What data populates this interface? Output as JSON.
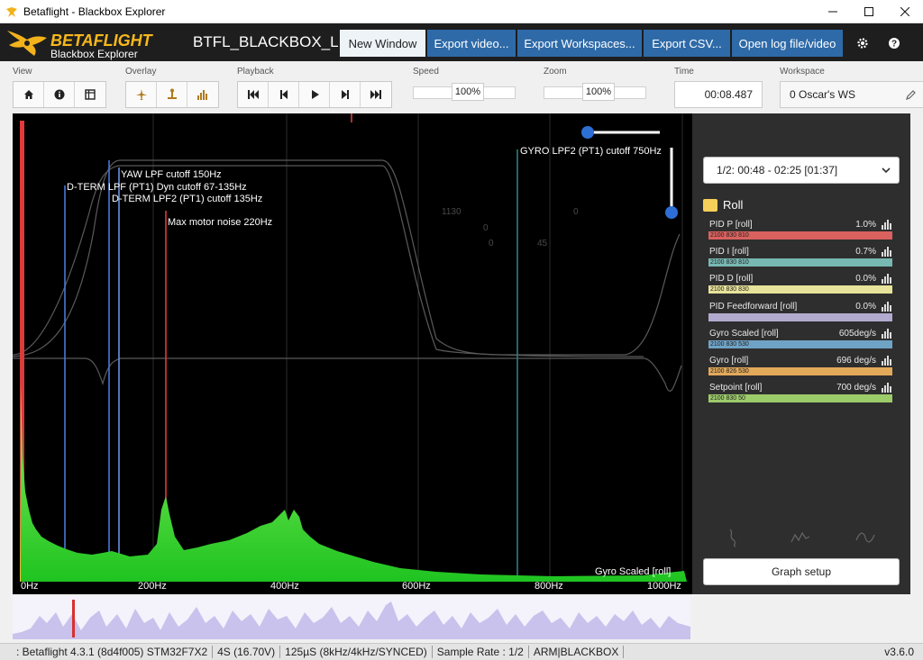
{
  "window": {
    "title": "Betaflight - Blackbox Explorer"
  },
  "header": {
    "logo_main": "BETAFLIGHT",
    "logo_sub": "Blackbox Explorer",
    "log_name": "BTFL_BLACKBOX_LO",
    "buttons": {
      "new_window": "New Window",
      "export_video": "Export video...",
      "export_workspaces": "Export Workspaces...",
      "export_csv": "Export CSV...",
      "open_log": "Open log file/video"
    },
    "icons": [
      "settings-icon",
      "help-icon"
    ]
  },
  "toolbar": {
    "labels": {
      "view": "View",
      "overlay": "Overlay",
      "playback": "Playback",
      "speed": "Speed",
      "zoom": "Zoom",
      "time": "Time",
      "workspace": "Workspace"
    },
    "speed_value": "100%",
    "zoom_value": "100%",
    "time_value": "00:08.487",
    "workspace_value": "0 Oscar's WS"
  },
  "analyser": {
    "annotations": {
      "gyro_lpf2": "GYRO LPF2 (PT1) cutoff 750Hz",
      "yaw_lpf": "YAW LPF cutoff 150Hz",
      "dterm_lpf": "D-TERM LPF (PT1) Dyn cutoff 67-135Hz",
      "dterm_lpf2": "D-TERM LPF2 (PT1) cutoff 135Hz",
      "max_motor_noise": "Max motor noise 220Hz",
      "series_label": "Gyro Scaled [roll]"
    },
    "faint_labels": {
      "a": "1130",
      "b": "0",
      "c": "0",
      "d": "45",
      "e": "0"
    },
    "x_ticks": [
      "0Hz",
      "200Hz",
      "400Hz",
      "600Hz",
      "800Hz",
      "1000Hz"
    ],
    "colors": {
      "spectrum": "#34e02a",
      "marker_red": "#e23a3a",
      "marker_blue": "#4a78d8",
      "background": "#000000"
    }
  },
  "panel": {
    "range": "1/2: 00:48 - 02:25 [01:37]",
    "group_name": "Roll",
    "fields": [
      {
        "name": "PID P [roll]",
        "value": "1.0%",
        "tag": "2100 830 810",
        "color": "#d9615e"
      },
      {
        "name": "PID I [roll]",
        "value": "0.7%",
        "tag": "2100 830 810",
        "color": "#78b8b3"
      },
      {
        "name": "PID D [roll]",
        "value": "0.0%",
        "tag": "2100 830 830",
        "color": "#e8e39a"
      },
      {
        "name": "PID Feedforward [roll]",
        "value": "0.0%",
        "tag": "",
        "color": "#b3abcf"
      },
      {
        "name": "Gyro Scaled [roll]",
        "value": "605deg/s",
        "tag": "2100 830 530",
        "color": "#6fa3c6"
      },
      {
        "name": "Gyro [roll]",
        "value": "696 deg/s",
        "tag": "2100 826 530",
        "color": "#e2a95a"
      },
      {
        "name": "Setpoint [roll]",
        "value": "700 deg/s",
        "tag": "2100 830 50",
        "color": "#9ccb6a"
      }
    ],
    "graph_setup": "Graph setup"
  },
  "statusbar": {
    "firmware": ": Betaflight 4.3.1 (8d4f005) STM32F7X2",
    "battery": "4S (16.70V)",
    "looptime": "125µS (8kHz/4kHz/SYNCED)",
    "sample_rate": "Sample Rate : 1/2",
    "flags": "ARM|BLACKBOX",
    "version": "v3.6.0"
  }
}
